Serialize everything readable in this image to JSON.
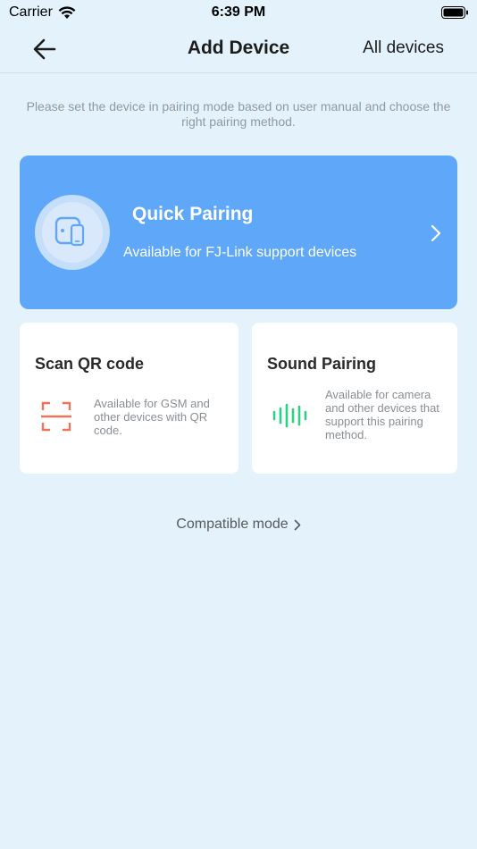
{
  "status_bar": {
    "carrier": "Carrier",
    "time": "6:39 PM"
  },
  "nav": {
    "title": "Add Device",
    "right_label": "All devices"
  },
  "instruction": "Please set the device in pairing mode based on user manual and choose the right pairing method.",
  "quick_pairing": {
    "title": "Quick Pairing",
    "subtitle": "Available for FJ-Link support devices",
    "color": "#5fa8f9"
  },
  "scan_qr": {
    "title": "Scan QR code",
    "description": "Available for GSM and other devices with QR code.",
    "icon_color": "#f0745a"
  },
  "sound_pairing": {
    "title": "Sound Pairing",
    "description": "Available for camera and other devices that support this pairing method.",
    "icon_color": "#2fcf86"
  },
  "compatible_mode": {
    "label": "Compatible mode"
  },
  "icons": {
    "back": "arrow-left-icon",
    "quick": "devices-icon",
    "qr": "scan-frame-icon",
    "sound": "sound-wave-icon",
    "chevron": "chevron-right-icon"
  }
}
